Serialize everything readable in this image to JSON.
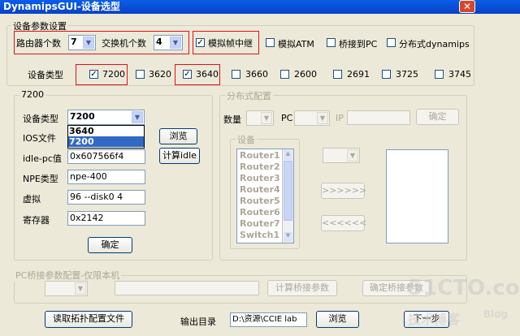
{
  "window": {
    "title": "DynamipsGUI-设备选型",
    "close": "✕"
  },
  "device_params": {
    "group_title": "设备参数设置",
    "router_count_label": "路由器个数",
    "router_count_value": "7",
    "switch_count_label": "交换机个数",
    "switch_count_value": "4",
    "frame_relay_label": "模拟帧中继",
    "frame_relay_checked": "✓",
    "atm_label": "模拟ATM",
    "bridge_pc_label": "桥接到PC",
    "distributed_label": "分布式dynamips",
    "device_type_label": "设备类型",
    "types": [
      {
        "label": "7200",
        "mark": "✓"
      },
      {
        "label": "3620",
        "mark": ""
      },
      {
        "label": "3640",
        "mark": "✓"
      },
      {
        "label": "3660",
        "mark": ""
      },
      {
        "label": "2600",
        "mark": ""
      },
      {
        "label": "2691",
        "mark": ""
      },
      {
        "label": "3725",
        "mark": ""
      },
      {
        "label": "3745",
        "mark": ""
      }
    ]
  },
  "model_panel": {
    "group_title": "7200",
    "device_type_label": "设备类型",
    "device_type_value": "7200",
    "dropdown_options": [
      "3640",
      "7200"
    ],
    "ios_label": "IOS文件",
    "browse_label": "浏览",
    "idle_pc_label": "idle-pc值",
    "idle_pc_value": "0x607566f4",
    "calc_idle_label": "计算idle",
    "npe_label": "NPE类型",
    "npe_value": "npe-400",
    "virtual_label": "虚拟",
    "virtual_value": "96 --disk0 4",
    "register_label": "寄存器",
    "register_value": "0x2142",
    "ok_label": "确定"
  },
  "distributed": {
    "group_title": "分布式配置",
    "count_label": "数量",
    "pc_label": "PC",
    "ip_label": "IP",
    "confirm_label": "确定",
    "devices_title": "设备",
    "devices": [
      "Router1",
      "Router2",
      "Router3",
      "Router4",
      "Router5",
      "Router6",
      "Router7",
      "Switch1"
    ],
    "add_label": ">>>>>>",
    "remove_label": "<<<<<<"
  },
  "bridge": {
    "group_title": "PC桥接参数配置-仅限本机",
    "calc_label": "计算桥接参数",
    "confirm_label": "确定桥接参数"
  },
  "footer": {
    "read_topology_label": "读取拓扑配置文件",
    "output_dir_label": "输出目录",
    "output_dir_value": "D:\\资源\\CCIE lab",
    "browse_label": "浏览",
    "next_label": "下一步"
  },
  "watermark": {
    "site": "51CTO.com",
    "sub": "技术博客",
    "blog": "Blog"
  }
}
